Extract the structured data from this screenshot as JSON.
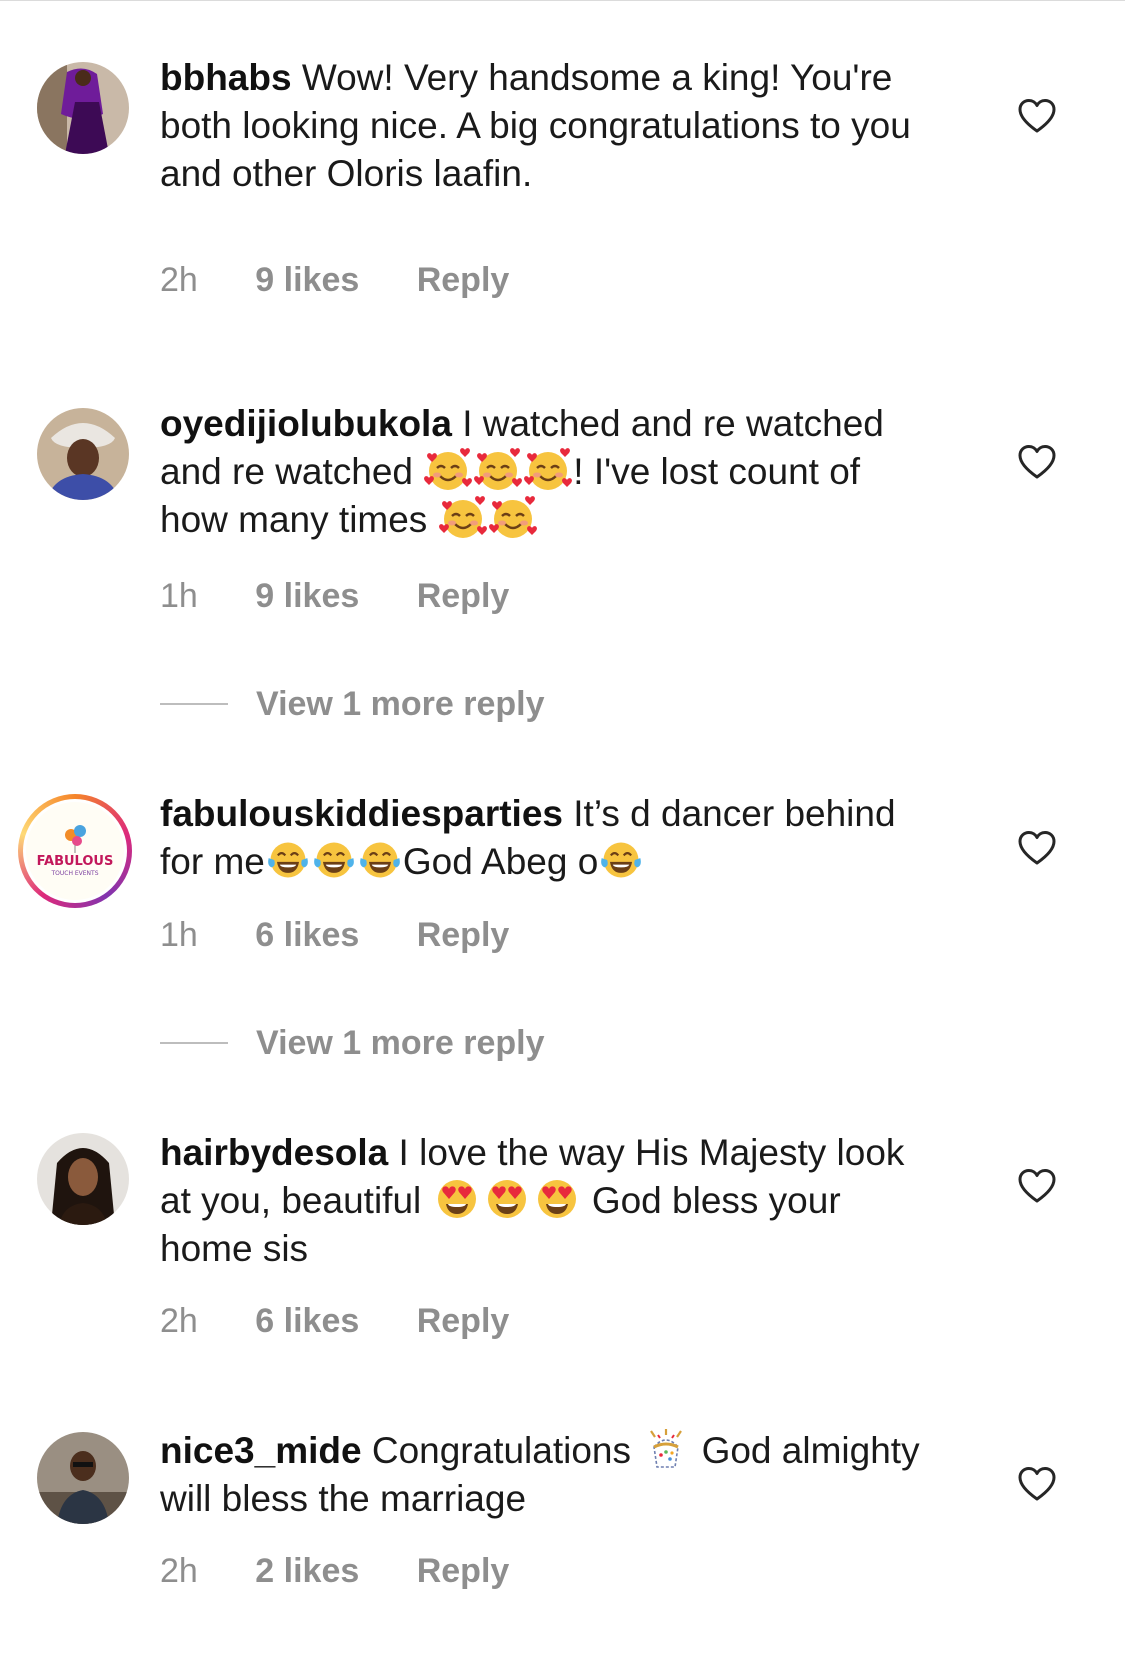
{
  "comments": [
    {
      "username": "bbhabs",
      "text": "Wow! Very handsome a king! You're both looking nice. A big congratulations to you and other Oloris laafin.",
      "time": "2h",
      "likes": "9 likes",
      "reply": "Reply"
    },
    {
      "username": "oyedijiolubukola",
      "text_part1": "I watched and re watched and re watched",
      "text_part2": "! I've lost count of how many times",
      "time": "1h",
      "likes": "9 likes",
      "reply": "Reply",
      "view_more": "View 1 more reply"
    },
    {
      "username": "fabulouskiddiesparties",
      "text_part1": "It’s d dancer behind for me",
      "text_part2": "God Abeg o",
      "time": "1h",
      "likes": "6 likes",
      "reply": "Reply",
      "view_more": "View 1 more reply",
      "avatar_logo_text": "FABULOUS",
      "avatar_logo_sub": "TOUCH EVENTS"
    },
    {
      "username": "hairbydesola",
      "text_part1": "I love the way His Majesty look at you, beautiful",
      "text_part2": "God bless your home sis",
      "time": "2h",
      "likes": "6 likes",
      "reply": "Reply"
    },
    {
      "username": "nice3_mide",
      "text_part1": "Congratulations",
      "text_part2": "God almighty will bless the marriage",
      "time": "2h",
      "likes": "2 likes",
      "reply": "Reply"
    }
  ],
  "icons": {
    "like": "heart-outline-icon",
    "smiling_hearts": "smiling-face-with-hearts-emoji",
    "tears_of_joy": "face-with-tears-of-joy-emoji",
    "heart_eyes": "heart-eyes-emoji",
    "confetti": "confetti-ball-emoji"
  },
  "colors": {
    "text": "#111111",
    "secondary": "#8e8e8e",
    "divider": "#dbdbdb"
  }
}
